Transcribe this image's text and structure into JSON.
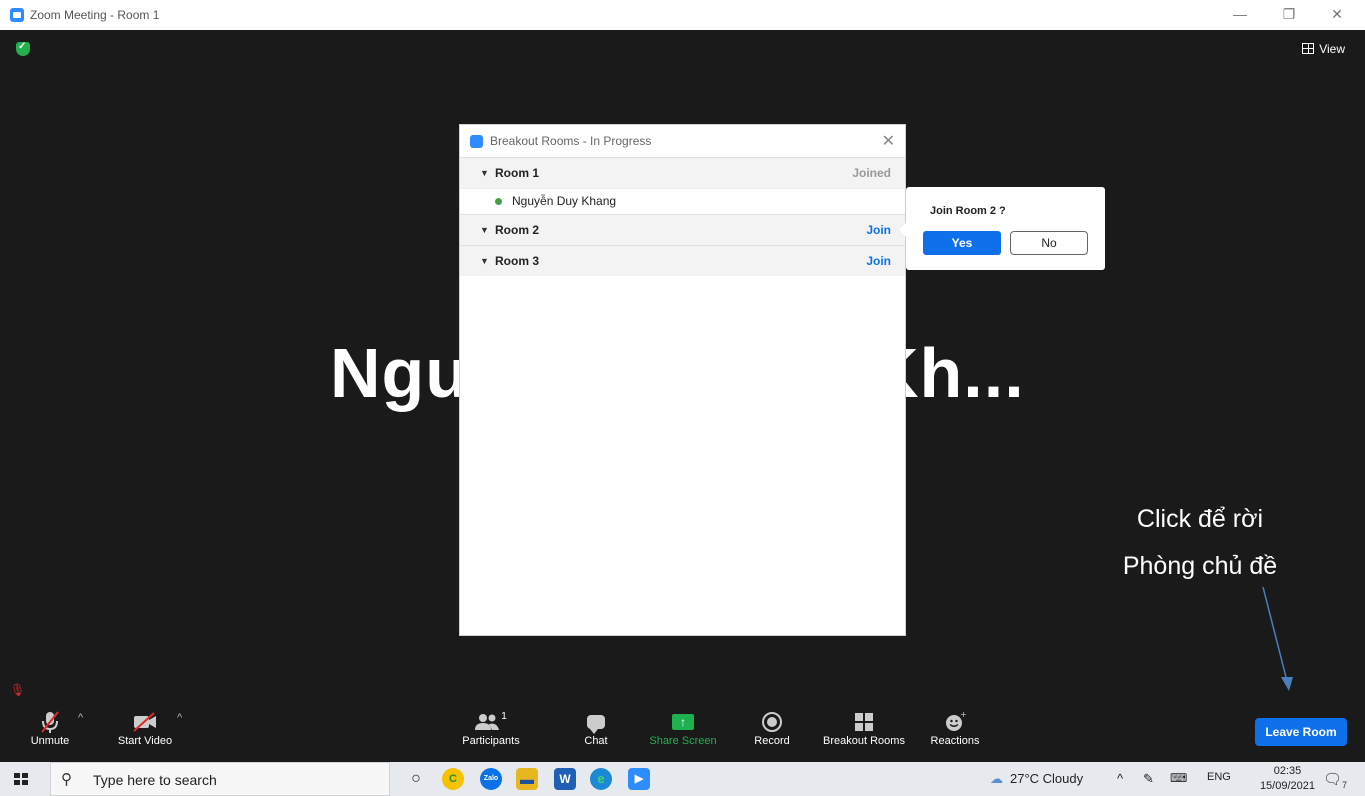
{
  "window": {
    "title": "Zoom Meeting - Room 1",
    "minimize": "—",
    "restore": "❐",
    "close": "✕"
  },
  "meeting": {
    "view_label": "View",
    "big_name_left": "Ngu",
    "big_name_right": "Kh..."
  },
  "breakout_dialog": {
    "title": "Breakout Rooms - In Progress",
    "close": "✕",
    "rooms": [
      {
        "name": "Room 1",
        "status": "Joined",
        "members": [
          "Nguyễn Duy Khang"
        ]
      },
      {
        "name": "Room 2",
        "status": "Join"
      },
      {
        "name": "Room 3",
        "status": "Join"
      }
    ]
  },
  "confirm_popup": {
    "text": "Join Room 2 ?",
    "yes": "Yes",
    "no": "No"
  },
  "annotation": {
    "line1": "Click để rời",
    "line2": "Phòng chủ đề"
  },
  "toolbar": {
    "unmute": "Unmute",
    "start_video": "Start Video",
    "participants": "Participants",
    "participants_count": "1",
    "chat": "Chat",
    "share_screen": "Share Screen",
    "record": "Record",
    "breakout_rooms": "Breakout Rooms",
    "reactions": "Reactions",
    "leave_room": "Leave Room"
  },
  "taskbar": {
    "search_placeholder": "Type here to search",
    "weather": "27°C  Cloudy",
    "language": "ENG",
    "time": "02:35",
    "date": "15/09/2021",
    "notification_count": "7"
  },
  "colors": {
    "accent": "#0e71eb",
    "share_green": "#1fb150",
    "joined_gray": "#999999",
    "join_blue": "#0e71eb"
  }
}
